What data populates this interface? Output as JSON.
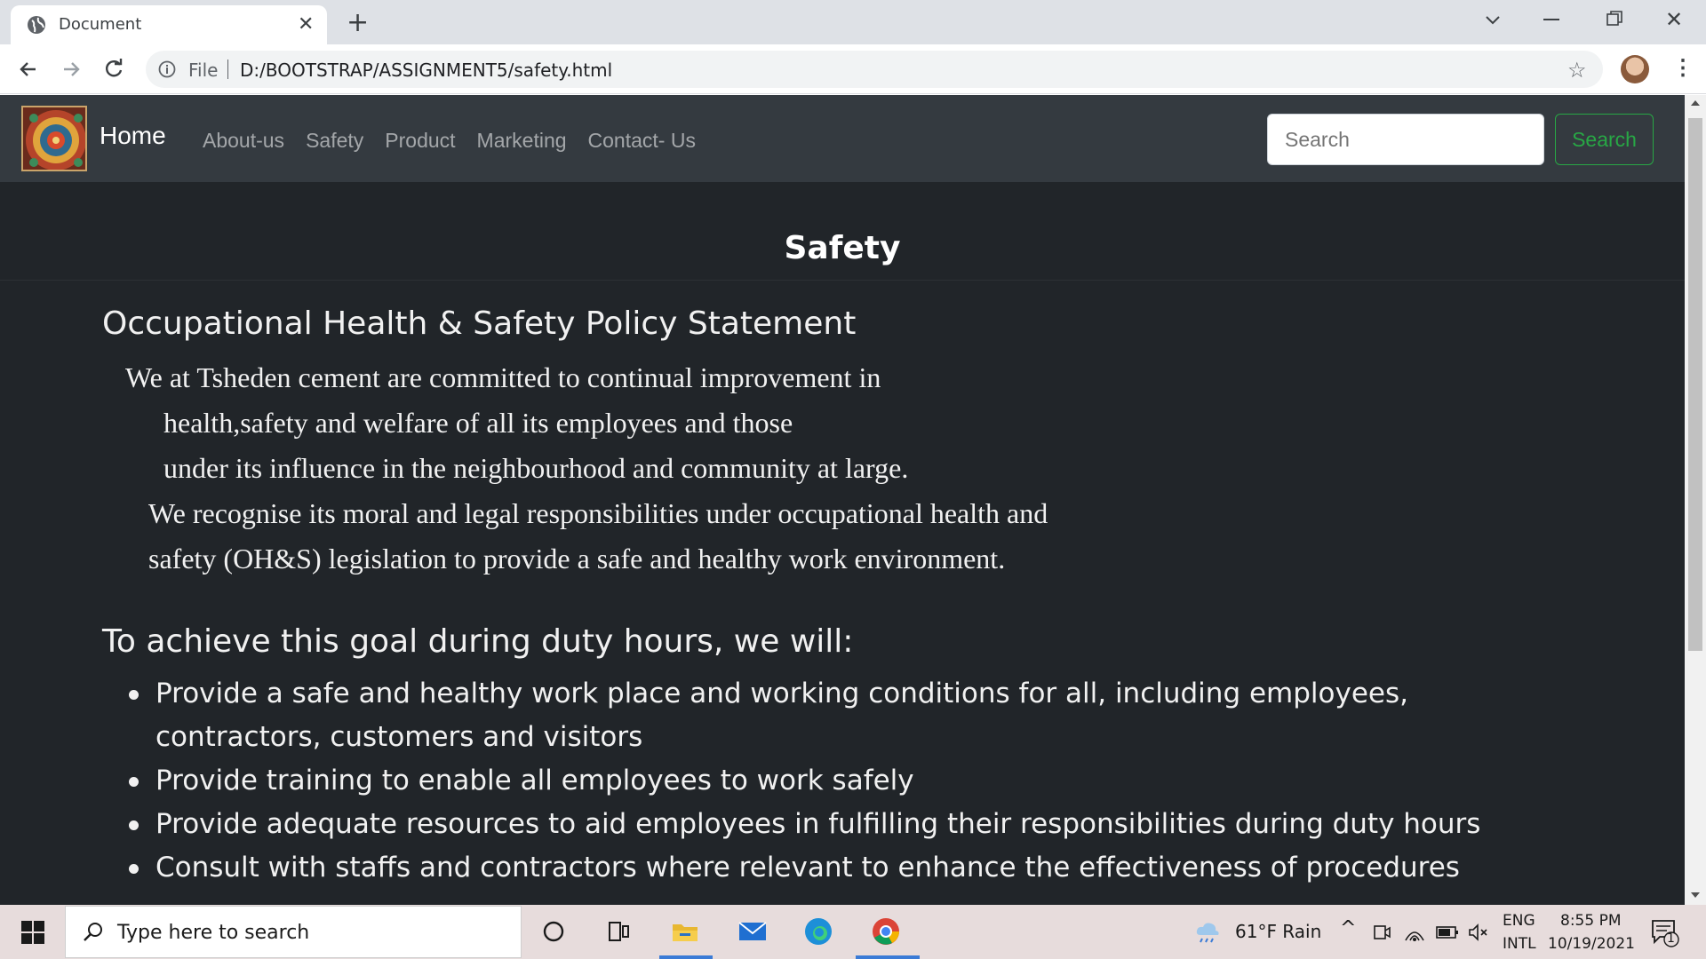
{
  "browser": {
    "tab_title": "Document",
    "tab_close": "✕",
    "new_tab": "+",
    "omnibox_scheme": "File",
    "url": "D:/BOOTSTRAP/ASSIGNMENT5/safety.html"
  },
  "navbar": {
    "brand": "Home",
    "links": [
      "About-us",
      "Safety",
      "Product",
      "Marketing",
      "Contact- Us"
    ],
    "search_placeholder": "Search",
    "search_button": "Search",
    "colors": {
      "bg": "#343a40",
      "search_green": "#28a745"
    }
  },
  "content": {
    "page_title": "Safety",
    "policy_heading": "Occupational Health & Safety Policy Statement",
    "policy_lines": [
      "We at Tsheden cement are committed to continual improvement in",
      "health,safety and welfare of all its employees and those",
      "under its influence in the neighbourhood and community at large.",
      "We recognise its moral and legal responsibilities under occupational health and",
      "safety (OH&S) legislation to provide a safe and healthy work environment."
    ],
    "goal_heading": "To achieve this goal during duty hours, we will:",
    "goal_items": [
      "Provide a safe and healthy work place and working conditions for all, including employees, contractors, customers and visitors",
      "Provide training to enable all employees to work safely",
      "Provide adequate resources to aid employees in fulfilling their responsibilities during duty hours",
      "Consult with staffs and contractors where relevant to enhance the effectiveness of procedures"
    ],
    "colors": {
      "bg": "#212529",
      "text": "#f1f1f1"
    }
  },
  "taskbar": {
    "search_placeholder": "Type here to search",
    "weather": "61°F  Rain",
    "lang_top": "ENG",
    "lang_bottom": "INTL",
    "time": "8:55 PM",
    "date": "10/19/2021",
    "notification_count": "1"
  }
}
